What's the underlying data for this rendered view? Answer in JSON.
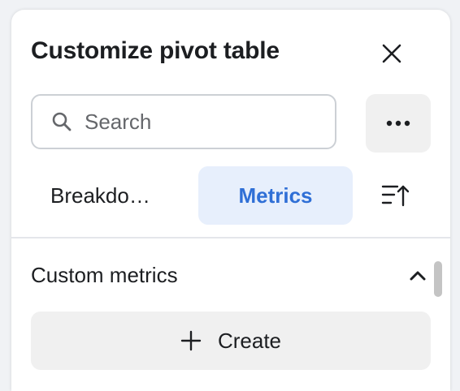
{
  "header": {
    "title": "Customize pivot table",
    "close_icon": "close-icon"
  },
  "search": {
    "placeholder": "Search",
    "value": "",
    "icon": "search-icon"
  },
  "more_button": {
    "icon": "more-horizontal-icon"
  },
  "tabs": [
    {
      "label": "Breakdo…",
      "selected": false
    },
    {
      "label": "Metrics",
      "selected": true
    }
  ],
  "sort_button": {
    "icon": "sort-ascending-icon"
  },
  "section": {
    "title": "Custom metrics",
    "chevron_icon": "chevron-up-icon",
    "create_label": "Create",
    "create_icon": "plus-icon"
  },
  "colors": {
    "accent_text": "#2f6fd6",
    "accent_bg": "#e7effc",
    "button_bg": "#f0f0f0",
    "border": "#ccd0d5"
  }
}
